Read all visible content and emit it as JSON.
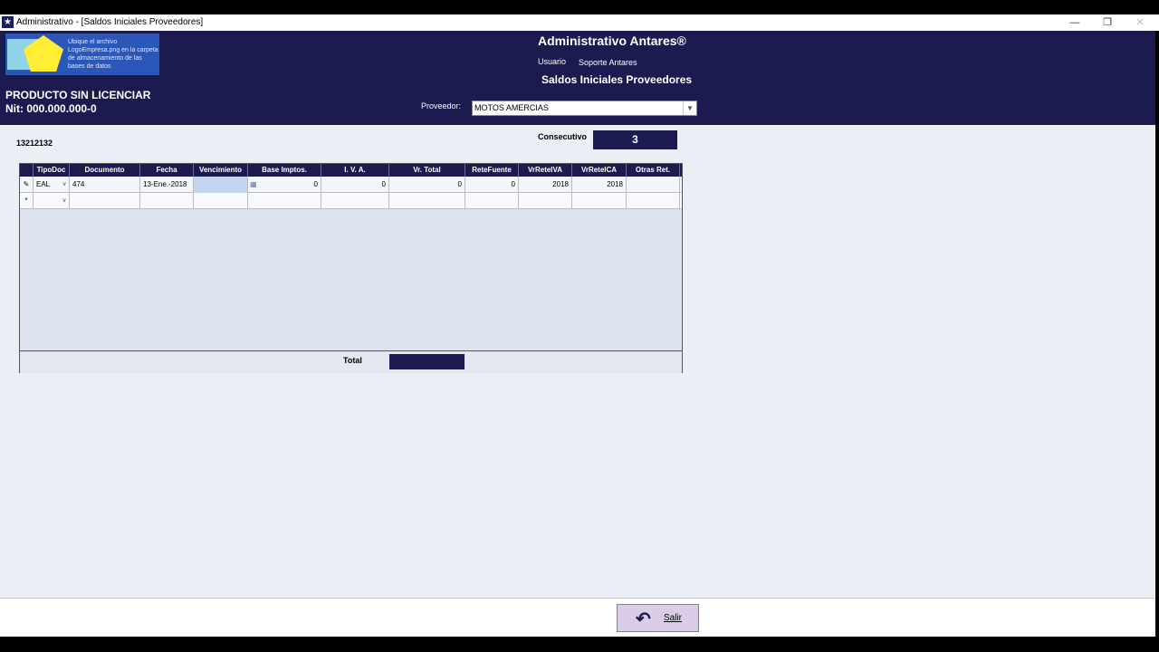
{
  "window": {
    "title": "Administrativo - [Saldos Iniciales Proveedores]",
    "minimize": "—",
    "restore": "❐",
    "close": "✕"
  },
  "header": {
    "logo_text": "Ubique el archivo LogoEmpresa.png en la carpeta de almacenamiento de las bases de datos",
    "license_line1": "PRODUCTO SIN LICENCIAR",
    "license_line2": "Nit: 000.000.000-0",
    "app_title": "Administrativo Antares®",
    "user_label": "Usuario",
    "user_value": "Soporte Antares",
    "module_title": "Saldos Iniciales Proveedores",
    "provider_label": "Proveedor:",
    "provider_value": "MOTOS AMERCIAS"
  },
  "main": {
    "code": "13212132",
    "consecutive_label": "Consecutivo",
    "consecutive_value": "3"
  },
  "grid": {
    "columns": [
      "TipoDoc",
      "Documento",
      "Fecha",
      "Vencimiento",
      "Base Imptos.",
      "I. V. A.",
      "Vr. Total",
      "ReteFuente",
      "VrReteIVA",
      "VrReteICA",
      "Otras Ret."
    ],
    "rows": [
      {
        "marker": "✎",
        "tipo_doc": "EAL",
        "documento": "474",
        "fecha": "13-Ene.-2018",
        "vencimiento": "",
        "base": "0",
        "iva": "0",
        "total": "0",
        "retefuente": "0",
        "reteiva": "2018",
        "reteica": "2018",
        "otras": ""
      }
    ],
    "new_row_marker": "*",
    "total_label": "Total",
    "total_value": ""
  },
  "footer": {
    "exit_label": "Salir"
  },
  "colors": {
    "navy": "#1b1b4f",
    "background": "#eceef6",
    "exit_button": "#d9cde8"
  }
}
